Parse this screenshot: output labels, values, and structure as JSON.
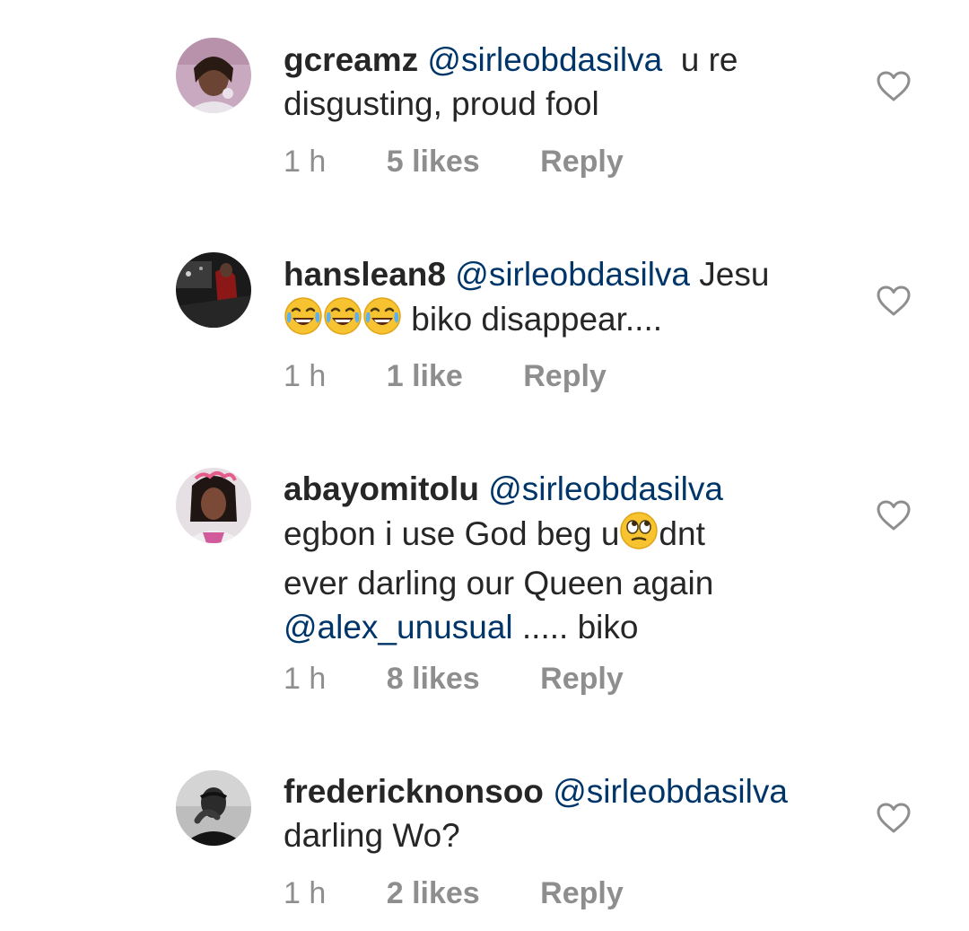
{
  "comments": [
    {
      "username": "gcreamz",
      "mention": "@sirleobdasilva",
      "text": "u re",
      "line2": "disgusting, proud fool",
      "time": "1 h",
      "likes": "5 likes",
      "reply": "Reply"
    },
    {
      "username": "hanslean8",
      "mention": "@sirleobdasilva",
      "text": "Jesu",
      "emojis": [
        "face-with-tears-of-joy",
        "face-with-tears-of-joy",
        "face-with-tears-of-joy"
      ],
      "line2": "biko disappear....",
      "time": "1 h",
      "likes": "1 like",
      "reply": "Reply"
    },
    {
      "username": "abayomitolu",
      "mention": "@sirleobdasilva",
      "line2a": "egbon i use God beg u",
      "emoji": "rolling-eyes-face",
      "line2b": "dnt",
      "line3": "ever darling our Queen again",
      "mention2": "@alex_unusual",
      "line4": "..... biko",
      "time": "1 h",
      "likes": "8 likes",
      "reply": "Reply"
    },
    {
      "username": "fredericknonsoo",
      "mention": "@sirleobdasilva",
      "line2": "darling Wo?",
      "time": "1 h",
      "likes": "2 likes",
      "reply": "Reply"
    }
  ],
  "colors": {
    "text": "#262626",
    "mention": "#003569",
    "meta": "#8e8e8e"
  }
}
